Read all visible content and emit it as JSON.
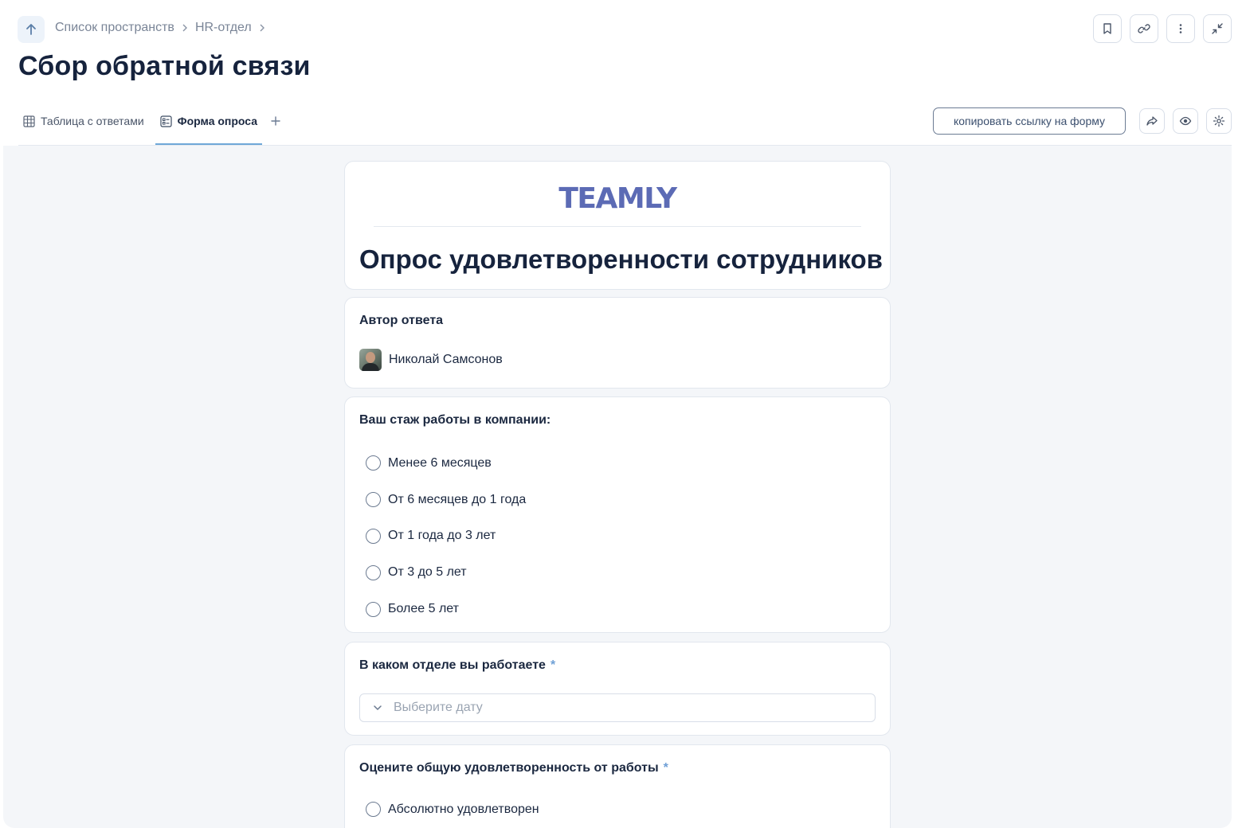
{
  "breadcrumb": {
    "items": [
      "Список пространств",
      "HR-отдел"
    ]
  },
  "page_title": "Сбор обратной связи",
  "tabs": [
    {
      "label": "Таблица с ответами",
      "icon": "table-icon"
    },
    {
      "label": "Форма опроса",
      "icon": "form-icon",
      "active": true
    }
  ],
  "copy_link_label": "копировать ссылку на форму",
  "form": {
    "logo": "TEAMLY",
    "title": "Опрос удовлетворенности сотрудников",
    "author": {
      "label": "Автор ответа",
      "name": "Николай Самсонов"
    },
    "q_stazh": {
      "title": "Ваш стаж работы в компании:",
      "options": [
        "Менее 6 месяцев",
        "От 6 месяцев до 1 года",
        "От 1 года до 3 лет",
        "От 3 до 5 лет",
        "Более 5 лет"
      ]
    },
    "q_dept": {
      "title": "В каком отделе вы работаете",
      "required_mark": "*",
      "placeholder": "Выберите дату"
    },
    "q_satisf": {
      "title": "Оцените общую удовлетворенность от работы",
      "required_mark": "*",
      "options": [
        "Абсолютно удовлетворен"
      ]
    }
  },
  "colors": {
    "accent": "#6fa8d8",
    "logo": "#5c6bb5",
    "text": "#16233d",
    "background": "#f4f6f9"
  }
}
